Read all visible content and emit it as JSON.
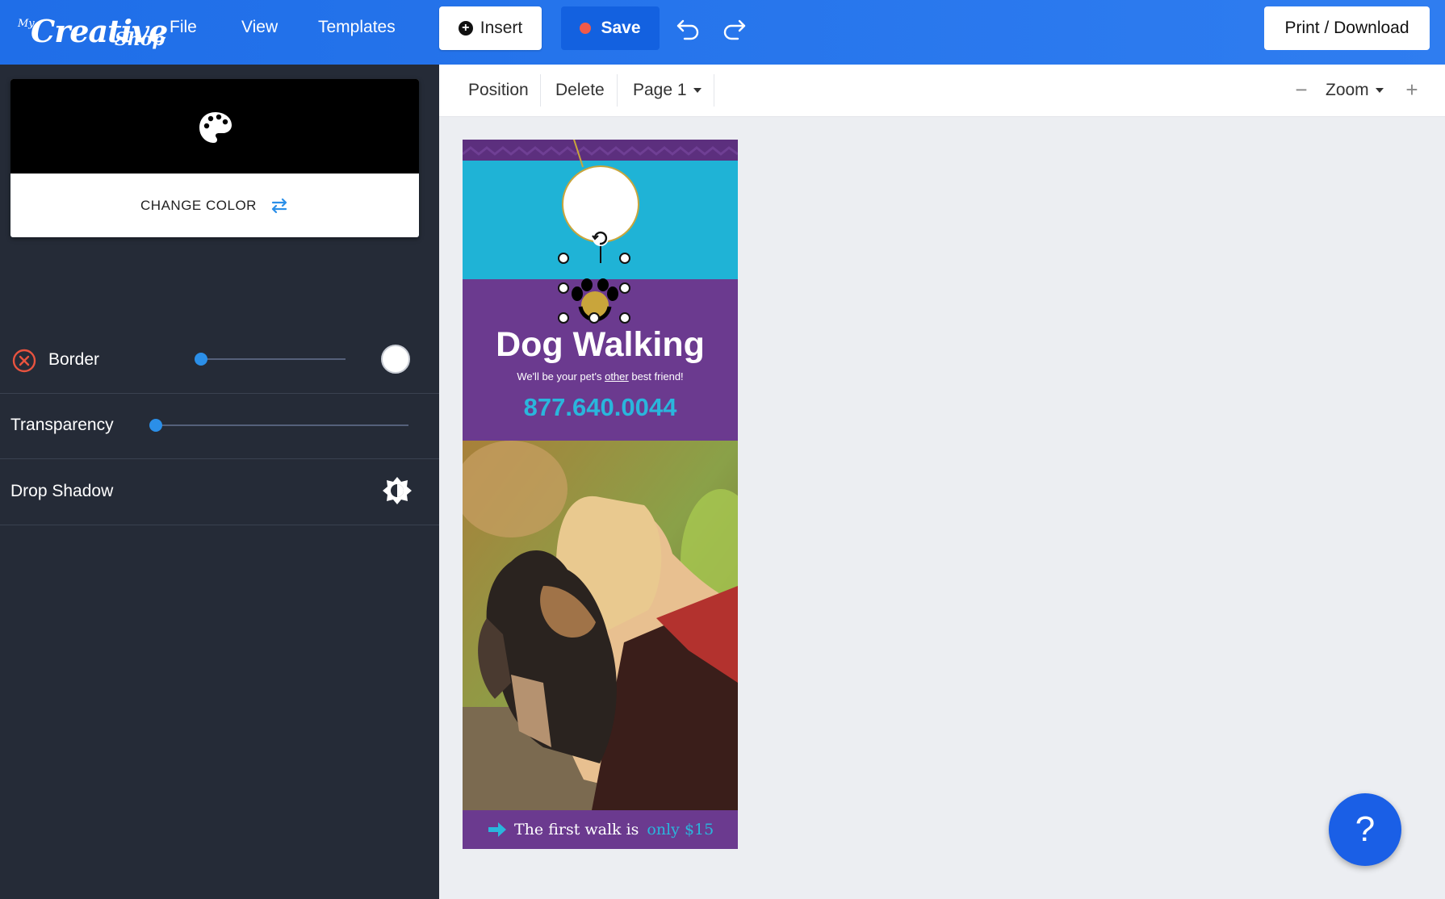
{
  "app": {
    "logo": {
      "prefix": "My",
      "word1": "Creative",
      "word2": "Shop"
    },
    "menu": [
      {
        "label": "File"
      },
      {
        "label": "View"
      },
      {
        "label": "Templates"
      }
    ],
    "insert_label": "Insert",
    "save_label": "Save",
    "print_label": "Print / Download",
    "colors": {
      "topbar": "#1f6ee8",
      "save": "#1361e0",
      "sidebar": "#252b37",
      "accent": "#2b8fe8"
    }
  },
  "sidebar": {
    "change_color_label": "CHANGE COLOR",
    "swatch_color": "#000000",
    "border": {
      "label": "Border",
      "value": 0,
      "color": "#ffffff"
    },
    "transparency": {
      "label": "Transparency",
      "value": 0
    },
    "drop_shadow": {
      "label": "Drop Shadow"
    }
  },
  "toolbar": {
    "position_label": "Position",
    "delete_label": "Delete",
    "page_label": "Page 1",
    "zoom_label": "Zoom"
  },
  "document": {
    "title": "Dog Walking",
    "tagline_pre": "We'll be your pet's ",
    "tagline_underlined": "other",
    "tagline_post": " best friend!",
    "phone": "877.640.0044",
    "footer_text": "The first walk is",
    "footer_highlight": "only $15"
  },
  "help": {
    "label": "?"
  }
}
